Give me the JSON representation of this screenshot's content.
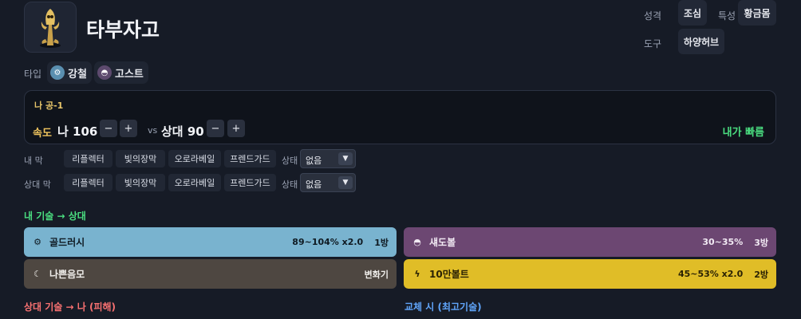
{
  "pokemon": {
    "name": "타부자고",
    "avatar_icon": "tabuzago-sprite"
  },
  "meta": {
    "nature_label": "성격",
    "nature_value": "조심",
    "ability_label": "특성",
    "ability_value": "황금몸",
    "item_label": "도구",
    "item_value": "하양허브"
  },
  "types": {
    "label": "타입",
    "items": [
      {
        "name": "강철",
        "icon": "steel-type-icon",
        "color": "#5a8fb0"
      },
      {
        "name": "고스트",
        "icon": "ghost-type-icon",
        "color": "#5d4a6e"
      }
    ]
  },
  "speed": {
    "rank": "나 공-1",
    "label": "속도",
    "mine": "나 106",
    "vs": "vs",
    "opponent": "상대 90",
    "minus": "−",
    "plus": "+",
    "result": "내가 빠름"
  },
  "screens": {
    "mine_label": "내 막",
    "opp_label": "상대 막",
    "buttons": [
      "리플렉터",
      "빛의장막",
      "오로라베일",
      "프렌드가드"
    ],
    "state_label": "상태",
    "state_value": "없음"
  },
  "my_moves": {
    "title": "내 기술 → 상대",
    "items": [
      {
        "name": "골드러시",
        "damage": "89~104% x2.0",
        "hits": "1방",
        "color": "#79b3cf",
        "text": "#0f1a22",
        "icon": "steel-type-icon"
      },
      {
        "name": "섀도볼",
        "damage": "30~35%",
        "hits": "3방",
        "color": "#6c4772",
        "text": "#f1e9f3",
        "icon": "ghost-type-icon"
      },
      {
        "name": "나쁜음모",
        "damage": "",
        "hits": "변화기",
        "color": "#4e4741",
        "text": "#f1efec",
        "icon": "dark-type-icon"
      },
      {
        "name": "10만볼트",
        "damage": "45~53% x2.0",
        "hits": "2방",
        "color": "#e0bd27",
        "text": "#2a2204",
        "icon": "electric-type-icon"
      }
    ]
  },
  "opp_section": {
    "title": "상대 기술 → 나 (피해)"
  },
  "switch_section": {
    "title": "교체 시 (최고기술)"
  },
  "colors": {
    "accent_green": "#4ade80",
    "accent_red": "#f87171",
    "accent_blue": "#60a5fa"
  }
}
